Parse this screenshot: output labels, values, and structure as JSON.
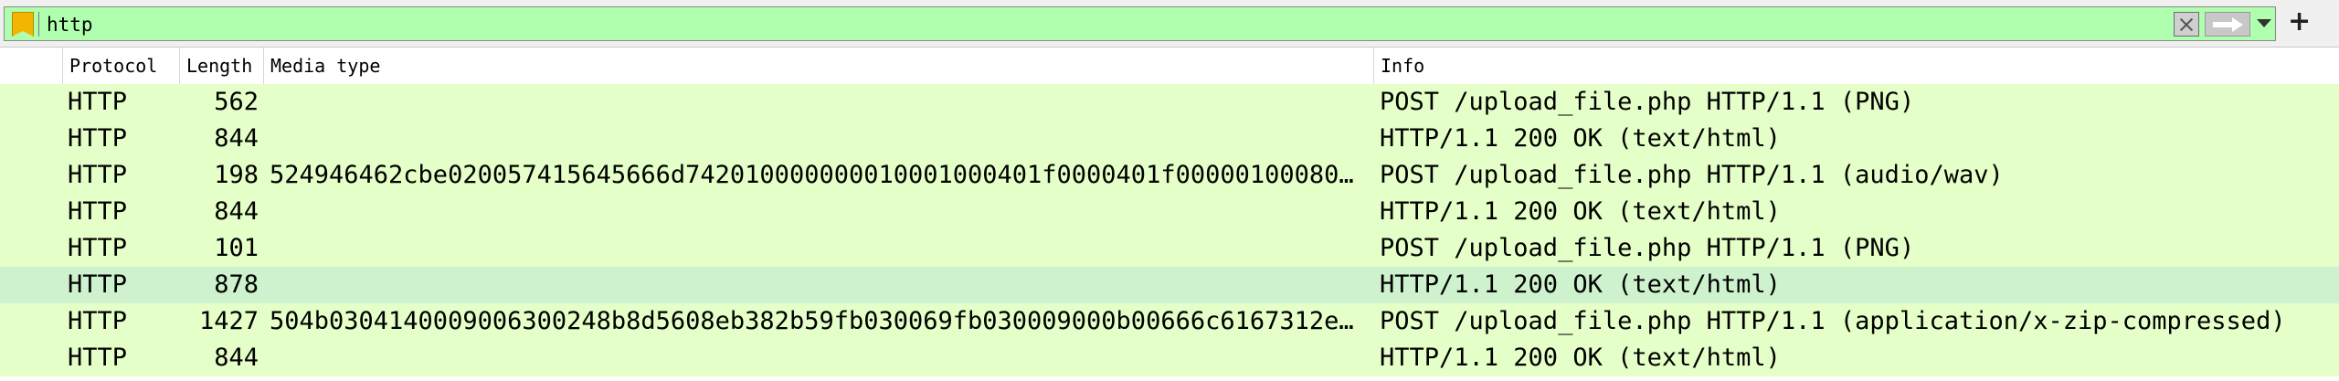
{
  "filter": {
    "value": "http",
    "background_color": "#afffaf",
    "bookmark_icon": "bookmark-icon",
    "clear_icon": "clear-x-icon",
    "apply_icon": "arrow-right-icon",
    "dropdown_icon": "chevron-down-icon",
    "add_label": "+"
  },
  "columns": {
    "protocol": "Protocol",
    "length": "Length",
    "media_type": "Media type",
    "info": "Info"
  },
  "colors": {
    "row_background": "#e4ffc7",
    "selected_row_background": "#cdf2cd"
  },
  "packets": [
    {
      "protocol": "HTTP",
      "length": "562",
      "media_type": "",
      "info": "POST /upload_file.php HTTP/1.1  (PNG)",
      "selected": false
    },
    {
      "protocol": "HTTP",
      "length": "844",
      "media_type": "",
      "info": "HTTP/1.1 200 OK  (text/html)",
      "selected": false
    },
    {
      "protocol": "HTTP",
      "length": "198",
      "media_type": "524946462cbe020057415645666d742010000000010001000401f0000401f00000100080…",
      "info": "POST /upload_file.php HTTP/1.1  (audio/wav)",
      "selected": false
    },
    {
      "protocol": "HTTP",
      "length": "844",
      "media_type": "",
      "info": "HTTP/1.1 200 OK  (text/html)",
      "selected": false
    },
    {
      "protocol": "HTTP",
      "length": "101",
      "media_type": "",
      "info": "POST /upload_file.php HTTP/1.1  (PNG)",
      "selected": false
    },
    {
      "protocol": "HTTP",
      "length": "878",
      "media_type": "",
      "info": "HTTP/1.1 200 OK  (text/html)",
      "selected": true
    },
    {
      "protocol": "HTTP",
      "length": "1427",
      "media_type": "504b0304140009006300248b8d5608eb382b59fb030069fb030009000b00666c6167312e…",
      "info": "POST /upload_file.php HTTP/1.1  (application/x-zip-compressed)",
      "selected": false
    },
    {
      "protocol": "HTTP",
      "length": "844",
      "media_type": "",
      "info": "HTTP/1.1 200 OK  (text/html)",
      "selected": false
    }
  ]
}
